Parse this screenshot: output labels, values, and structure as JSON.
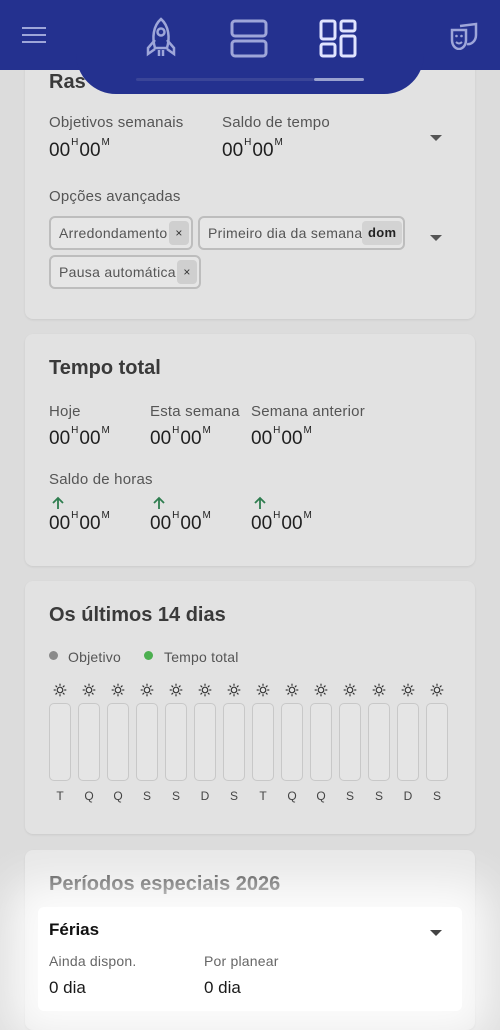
{
  "header": {
    "menu_icon": "hamburger-icon",
    "tabs": [
      {
        "icon": "rocket-icon",
        "active": false
      },
      {
        "icon": "rows-layout-icon",
        "active": false
      },
      {
        "icon": "dashboard-grid-icon",
        "active": true
      }
    ],
    "right_icon": "theater-masks-icon",
    "accent": "#24318f"
  },
  "tracking": {
    "title_partial": "Ras",
    "weekly_goals_label": "Objetivos semanais",
    "weekly_goals_h": "00",
    "weekly_goals_m": "00",
    "time_balance_label": "Saldo de tempo",
    "time_balance_h": "00",
    "time_balance_m": "00",
    "advanced_options_label": "Opções avançadas",
    "chips": [
      {
        "label": "Arredondamento",
        "remove": "×"
      },
      {
        "label": "Primeiro dia da semana",
        "value": "dom"
      },
      {
        "label": "Pausa automática",
        "remove": "×"
      }
    ]
  },
  "total": {
    "title": "Tempo total",
    "today_label": "Hoje",
    "today_h": "00",
    "today_m": "00",
    "week_label": "Esta semana",
    "week_h": "00",
    "week_m": "00",
    "prev_week_label": "Semana anterior",
    "prev_week_h": "00",
    "prev_week_m": "00",
    "balance_label": "Saldo de horas",
    "balance": [
      {
        "h": "00",
        "m": "00"
      },
      {
        "h": "00",
        "m": "00"
      },
      {
        "h": "00",
        "m": "00"
      }
    ],
    "up_color": "#2e7d4f"
  },
  "last14": {
    "title": "Os últimos 14 dias",
    "legend_goal": "Objetivo",
    "legend_total": "Tempo total",
    "goal_color": "#8a8a8a",
    "total_color": "#4caf50",
    "days": [
      "T",
      "Q",
      "Q",
      "S",
      "S",
      "D",
      "S",
      "T",
      "Q",
      "Q",
      "S",
      "S",
      "D",
      "S"
    ]
  },
  "special": {
    "title": "Períodos especiais 2026",
    "vacation_title": "Férias",
    "available_label": "Ainda dispon.",
    "available_value": "0 dia",
    "to_plan_label": "Por planear",
    "to_plan_value": "0 dia"
  },
  "units": {
    "h": "H",
    "m": "M"
  }
}
